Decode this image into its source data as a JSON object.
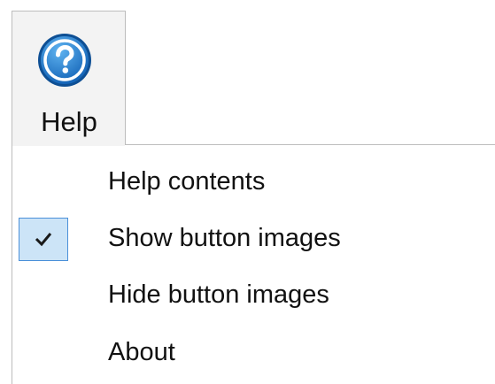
{
  "ribbon": {
    "help_button": {
      "label": "Help",
      "icon": "question-circle-icon",
      "icon_color": "#1e7fd1"
    }
  },
  "menu": {
    "items": [
      {
        "label": "Help contents",
        "checked": false
      },
      {
        "label": "Show button images",
        "checked": true
      },
      {
        "label": "Hide button images",
        "checked": false
      },
      {
        "label": "About",
        "checked": false
      }
    ],
    "check_highlight_color": "#cce4f7",
    "check_border_color": "#4a90d9"
  }
}
